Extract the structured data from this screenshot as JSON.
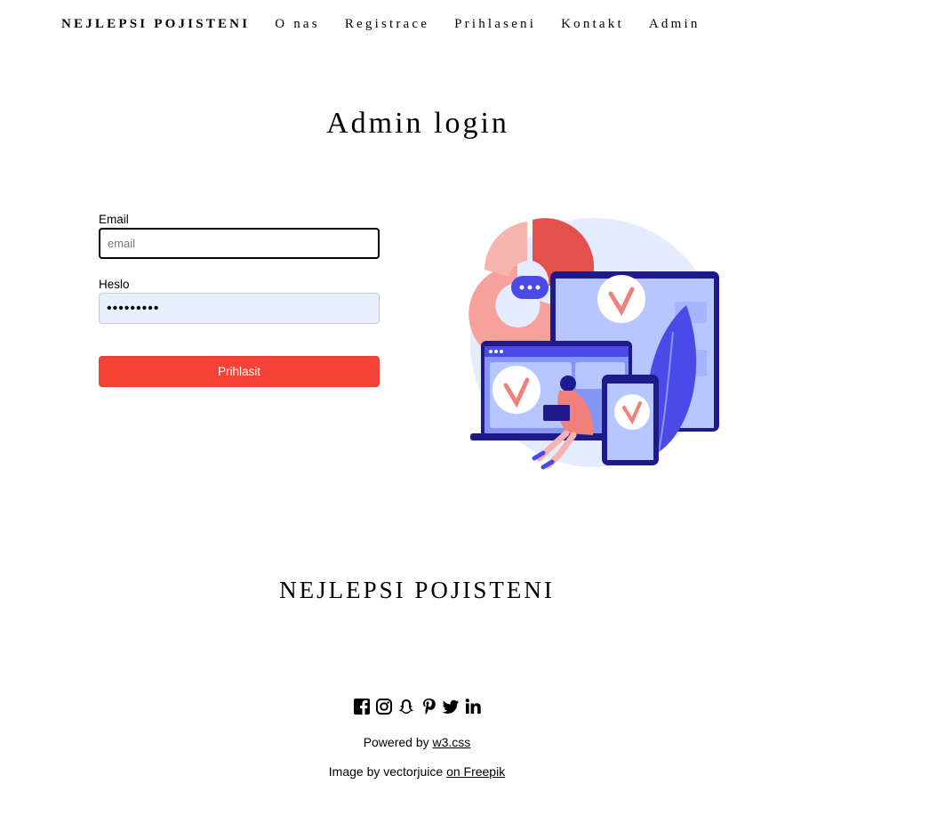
{
  "nav": {
    "brand": "NEJLEPSI POJISTENI",
    "items": [
      "O nas",
      "Registrace",
      "Prihlaseni",
      "Kontakt",
      "Admin"
    ]
  },
  "page_title": "Admin login",
  "form": {
    "email_label": "Email",
    "email_placeholder": "email",
    "password_label": "Heslo",
    "password_value": "•••••••••",
    "submit_label": "Prihlasit"
  },
  "footer": {
    "brand": "NEJLEPSI POJISTENI",
    "social_icons": [
      "facebook-icon",
      "instagram-icon",
      "snapchat-icon",
      "pinterest-icon",
      "twitter-icon",
      "linkedin-icon"
    ],
    "powered_prefix": "Powered by ",
    "powered_link": "w3.css",
    "image_prefix": "Image by vectorjuice ",
    "image_link": "on Freepik"
  },
  "colors": {
    "accent": "#f44336",
    "illustration_blue": "#4a4ae8",
    "illustration_coral": "#f0807a",
    "illustration_bg": "#e6ecff"
  }
}
